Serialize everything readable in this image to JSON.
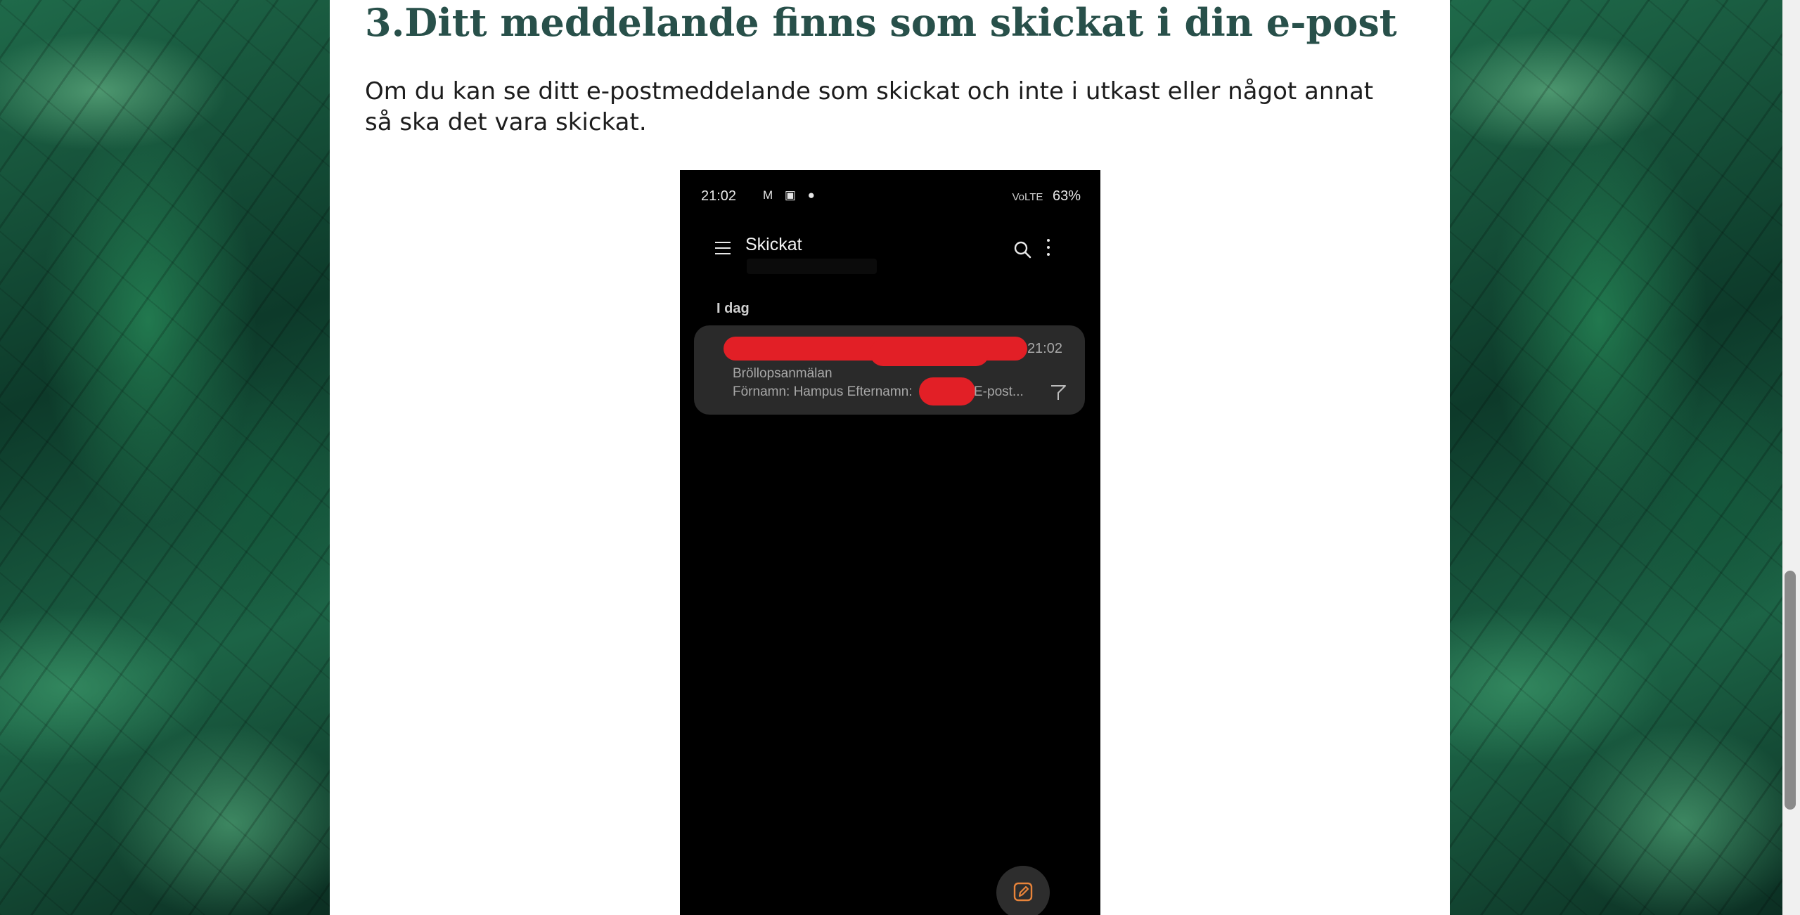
{
  "article": {
    "heading": "3.Ditt meddelande finns som skickat i din e-post",
    "paragraph": "Om du kan se ditt e-postmeddelande som skickat och inte i utkast eller något annat så ska det vara skickat."
  },
  "phone": {
    "status": {
      "time": "21:02",
      "notifications": "M ▣ ●",
      "signal": "VoLTE",
      "battery": "63%"
    },
    "app_title": "Skickat",
    "section_label": "I dag",
    "mail": {
      "time": "21:02",
      "subject": "Bröllopsanmälan",
      "preview": "Förnamn: Hampus  Efternamn:",
      "preview_tail": "E-post..."
    }
  },
  "colors": {
    "heading": "#28504a",
    "redaction": "#e21f26",
    "compose_accent": "#e8843a"
  }
}
